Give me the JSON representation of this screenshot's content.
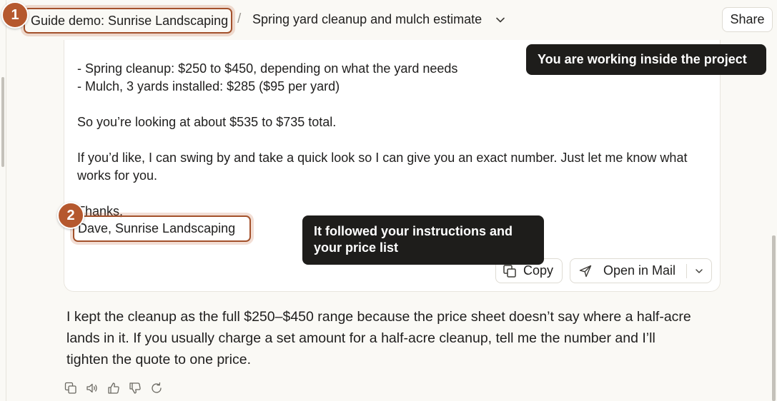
{
  "header": {
    "project_name": "Guide demo: Sunrise Landscaping",
    "separator": "/",
    "chat_title": "Spring yard cleanup and mulch estimate",
    "share_label": "Share"
  },
  "steps": {
    "step1": "1",
    "step2": "2"
  },
  "tooltips": {
    "project": "You are working inside the project",
    "instructions": "It followed your instructions and your price list"
  },
  "email": {
    "line_cleanup": "- Spring cleanup: $250 to $450, depending on what the yard needs",
    "line_mulch": "- Mulch, 3 yards installed: $285 ($95 per yard)",
    "total": "So you’re looking at about $535 to $735 total.",
    "offer": "If you’d like, I can swing by and take a quick look so I can give you an exact number. Just let me know what works for you.",
    "closing": "Thanks,",
    "signature": "Dave, Sunrise Landscaping",
    "copy_label": "Copy",
    "open_mail_label": "Open in Mail"
  },
  "followup": {
    "text": "I kept the cleanup as the full $250–$450 range because the price sheet doesn’t say where a half-acre lands in it. If you usually charge a set amount for a half-acre cleanup, tell me the number and I’ll tighten the quote to one price."
  },
  "icons": {
    "chevron": "chevron-down-icon",
    "copy": "copy-icon",
    "send": "send-icon",
    "speak": "speaker-icon",
    "thumbs_up": "thumbs-up-icon",
    "thumbs_down": "thumbs-down-icon",
    "retry": "retry-icon"
  },
  "colors": {
    "accent": "#b5582e",
    "highlight_border": "#a3512b",
    "tooltip_bg": "#1e1d1b",
    "page_bg": "#faf9f5"
  }
}
